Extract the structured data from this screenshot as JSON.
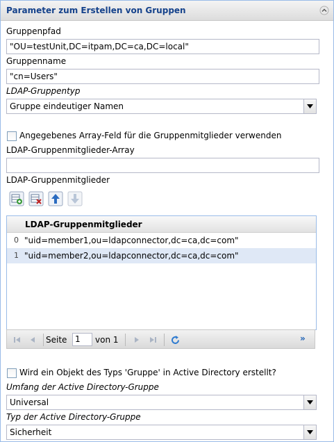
{
  "panel": {
    "title": "Parameter zum Erstellen von Gruppen",
    "collapse_icon": "chevron-up-icon"
  },
  "group_path": {
    "label": "Gruppenpfad",
    "value": "\"OU=testUnit,DC=itpam,DC=ca,DC=local\""
  },
  "group_name": {
    "label": "Gruppenname",
    "value": "\"cn=Users\""
  },
  "group_type": {
    "label": "LDAP-Gruppentyp",
    "selected": "Gruppe eindeutiger Namen"
  },
  "use_array": {
    "label": "Angegebenes Array-Feld für die Gruppenmitglieder verwenden",
    "checked": false
  },
  "members_array": {
    "label": "LDAP-Gruppenmitglieder-Array",
    "value": ""
  },
  "members": {
    "label": "LDAP-Gruppenmitglieder",
    "toolbar_icons": [
      "add-row-icon",
      "delete-row-icon",
      "move-up-icon",
      "move-down-icon"
    ],
    "column": "LDAP-Gruppenmitglieder",
    "rows": [
      {
        "index": "0",
        "value": "\"uid=member1,ou=ldapconnector,dc=ca,dc=com\""
      },
      {
        "index": "1",
        "value": "\"uid=member2,ou=ldapconnector,dc=ca,dc=com\""
      }
    ],
    "selected_row_color": "#dfe8f6"
  },
  "pager": {
    "page_label": "Seite",
    "page_value": "1",
    "of_label": "von 1",
    "more": "»"
  },
  "ad_object": {
    "label": "Wird ein Objekt des Typs 'Gruppe' in Active Directory erstellt?",
    "checked": false
  },
  "ad_scope": {
    "label": "Umfang der Active Directory-Gruppe",
    "selected": "Universal"
  },
  "ad_type": {
    "label": "Typ der Active Directory-Gruppe",
    "selected": "Sicherheit"
  }
}
